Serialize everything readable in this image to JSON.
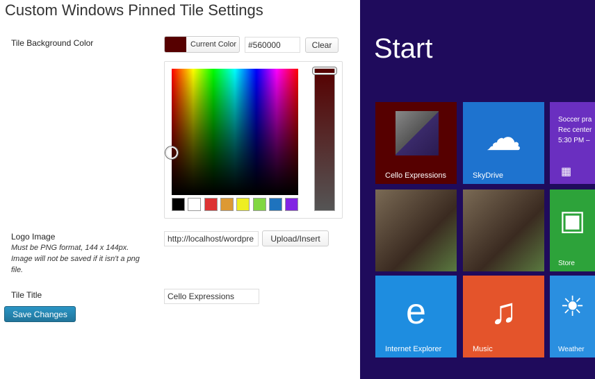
{
  "page_title": "Custom Windows Pinned Tile Settings",
  "bg_color": {
    "label": "Tile Background Color",
    "current_color_label": "Current Color",
    "value": "#560000",
    "clear_label": "Clear",
    "swatches": [
      "#000000",
      "#ffffff",
      "#dd3333",
      "#dd9933",
      "#eeee22",
      "#81d742",
      "#1e73be",
      "#8224e3"
    ]
  },
  "logo": {
    "label": "Logo Image",
    "note": "Must be PNG format, 144 x 144px. Image will not be saved if it isn't a png file.",
    "value": "http://localhost/wordpre",
    "upload_label": "Upload/Insert"
  },
  "tile_title": {
    "label": "Tile Title",
    "value": "Cello Expressions"
  },
  "save_label": "Save Changes",
  "preview": {
    "start_label": "Start",
    "tiles": [
      {
        "label": "Cello Expressions",
        "color": "#560000"
      },
      {
        "label": "SkyDrive",
        "color": "#1e73cf"
      },
      {
        "label": "",
        "color": "#6a2fc0",
        "lines": [
          "Soccer pra",
          "Rec center",
          "5:30 PM –"
        ]
      },
      {
        "label": "",
        "color": "#6b4a3a"
      },
      {
        "label": "",
        "color": "#8a6a50"
      },
      {
        "label": "Store",
        "color": "#2da33a"
      },
      {
        "label": "Internet Explorer",
        "color": "#1e8de0"
      },
      {
        "label": "Music",
        "color": "#e4542b"
      },
      {
        "label": "Weather",
        "color": "#2a8fe0"
      }
    ]
  }
}
